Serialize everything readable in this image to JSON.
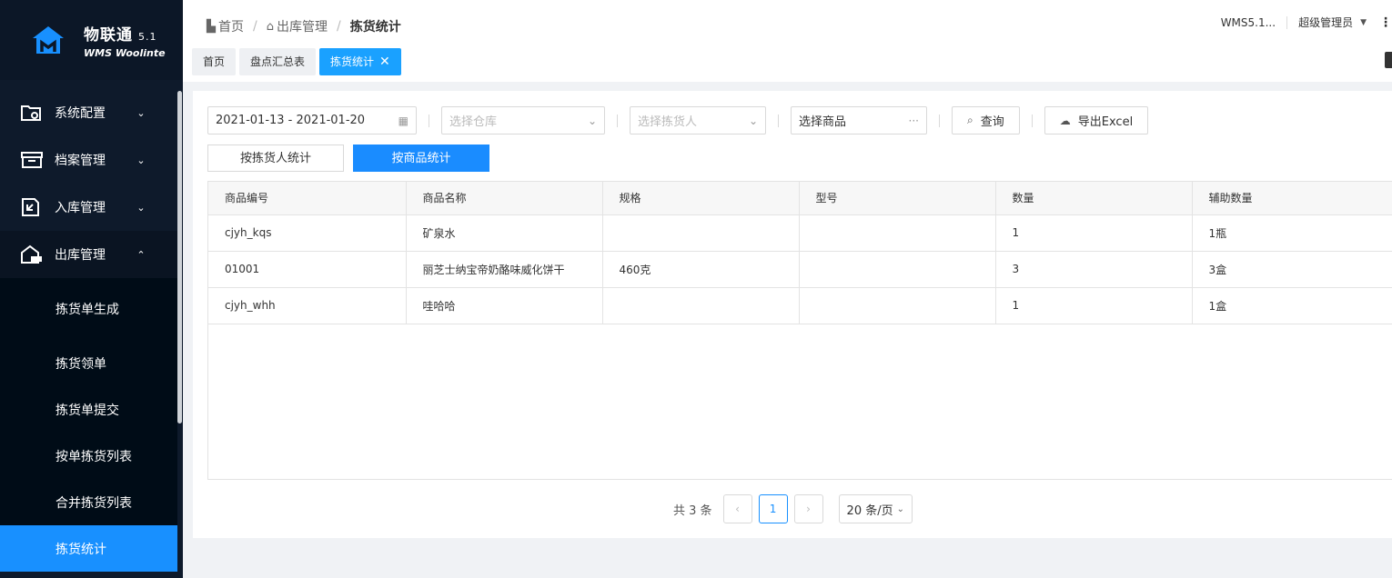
{
  "brand": {
    "title": "物联通",
    "version": "5.1",
    "subtitle": "WMS Woolinte",
    "color": "#1890ff"
  },
  "sidebar": {
    "menus": [
      {
        "label": "系统配置",
        "icon": "folder-gear-icon",
        "expanded": false
      },
      {
        "label": "档案管理",
        "icon": "archive-icon",
        "expanded": false
      },
      {
        "label": "入库管理",
        "icon": "inbound-icon",
        "expanded": false
      },
      {
        "label": "出库管理",
        "icon": "warehouse-truck-icon",
        "expanded": true
      }
    ],
    "submenu": [
      {
        "label": "拣货单生成"
      },
      {
        "label": "拣货领单"
      },
      {
        "label": "拣货单提交"
      },
      {
        "label": "按单拣货列表"
      },
      {
        "label": "合并拣货列表"
      },
      {
        "label": "拣货统计",
        "active": true
      }
    ]
  },
  "breadcrumb": {
    "home": "首页",
    "parent": "出库管理",
    "current": "拣货统计"
  },
  "header": {
    "system": "WMS5.1...",
    "user": "超级管理员"
  },
  "tabs": [
    {
      "label": "首页"
    },
    {
      "label": "盘点汇总表"
    },
    {
      "label": "拣货统计",
      "active": true
    }
  ],
  "filters": {
    "date_range": "2021-01-13 - 2021-01-20",
    "warehouse_placeholder": "选择仓库",
    "picker_placeholder": "选择拣货人",
    "product_label": "选择商品",
    "product_suffix": "···",
    "search_label": "查询",
    "export_label": "导出Excel"
  },
  "toggles": {
    "by_picker": "按拣货人统计",
    "by_product": "按商品统计"
  },
  "table": {
    "columns": [
      "商品编号",
      "商品名称",
      "规格",
      "型号",
      "数量",
      "辅助数量"
    ],
    "rows": [
      [
        "cjyh_kqs",
        "矿泉水",
        "",
        "",
        "1",
        "1瓶"
      ],
      [
        "01001",
        "丽芝士纳宝帝奶酪味威化饼干",
        "460克",
        "",
        "3",
        "3盒"
      ],
      [
        "cjyh_whh",
        "哇哈哈",
        "",
        "",
        "1",
        "1盒"
      ]
    ]
  },
  "pagination": {
    "total": "共 3 条",
    "current_page": "1",
    "page_size": "20 条/页"
  }
}
